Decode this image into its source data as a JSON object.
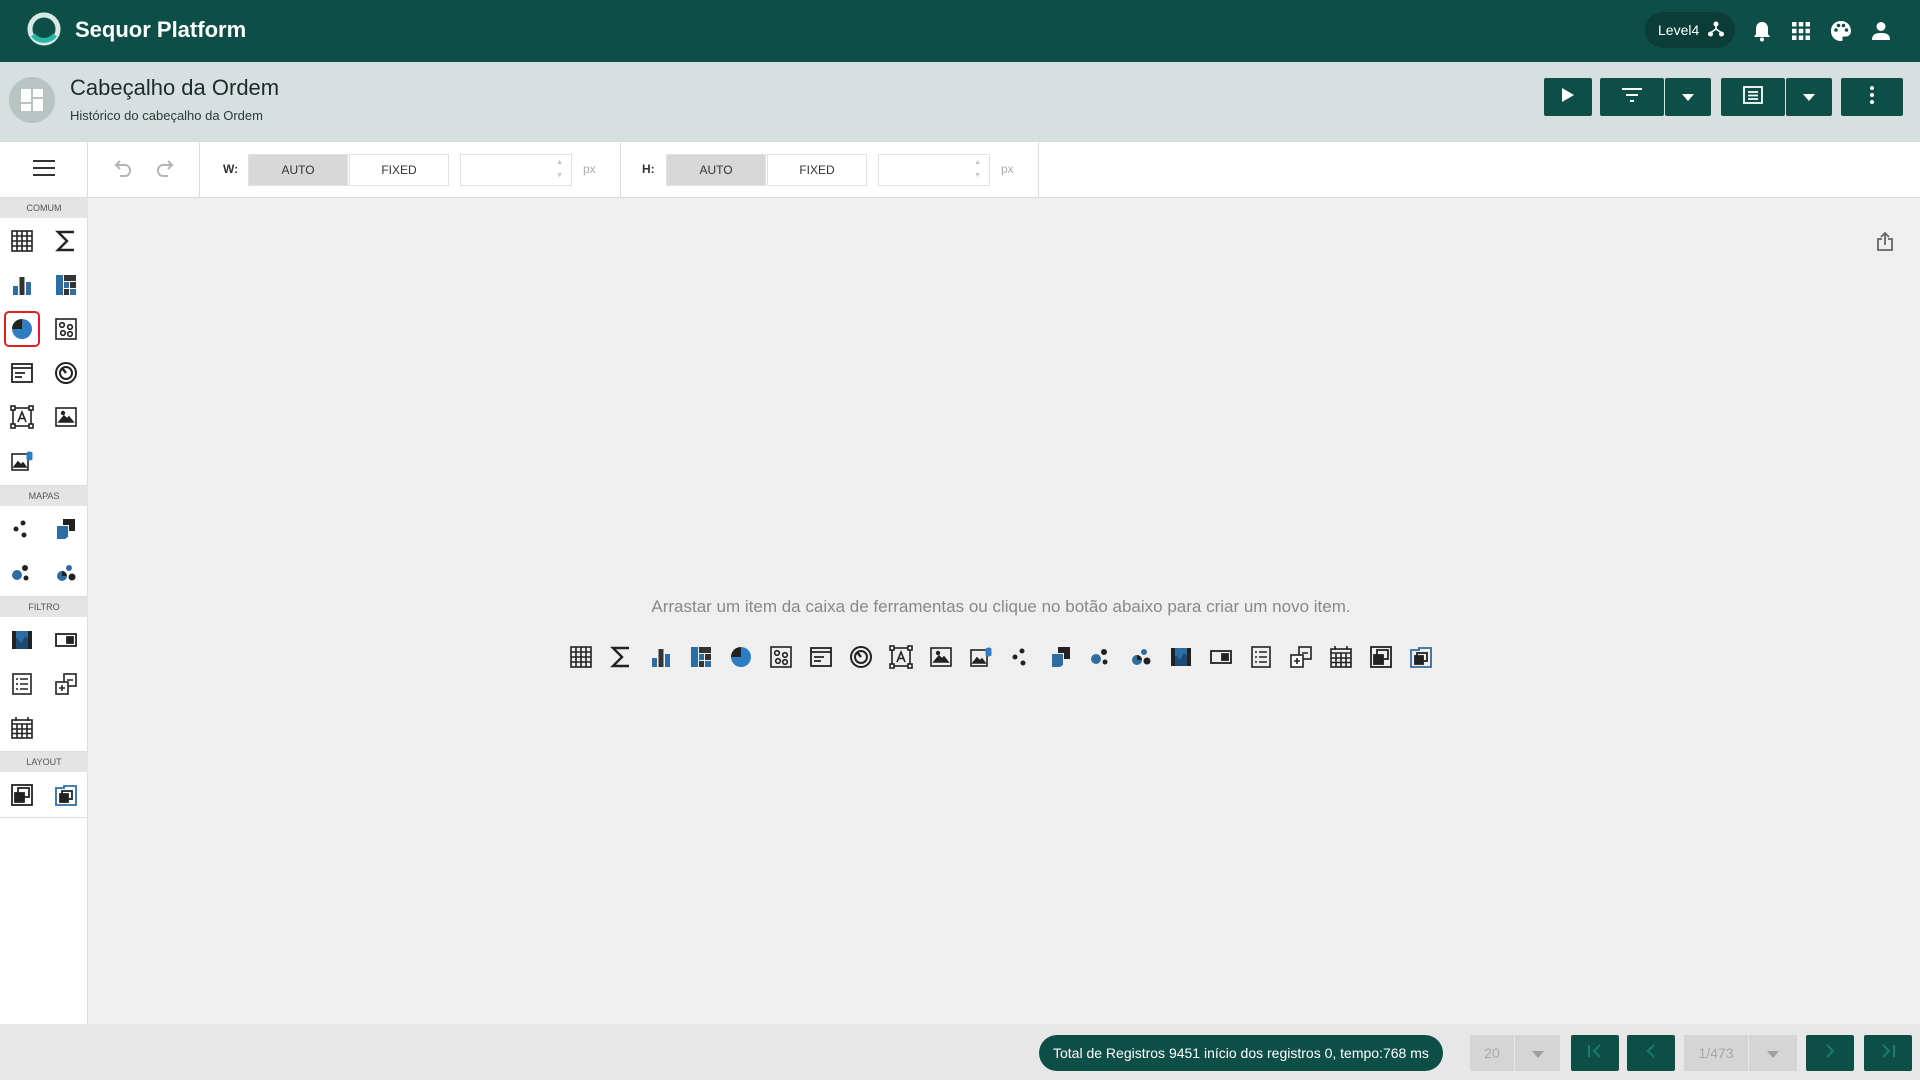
{
  "app": {
    "title": "Sequor Platform",
    "level_label": "Level4",
    "brand_color": "#0d4f47",
    "icons": [
      "logo-ring-icon",
      "hierarchy-icon",
      "bell-icon",
      "apps-grid-icon",
      "palette-icon",
      "user-icon"
    ]
  },
  "header": {
    "title": "Cabeçalho da Ordem",
    "subtitle": "Histórico do cabeçalho da Ordem",
    "buttons": [
      "play-icon",
      "filter-icon",
      "chevron-down-icon",
      "layout-list-icon",
      "chevron-down-icon",
      "more-vertical-icon"
    ]
  },
  "toolbar": {
    "width": {
      "label": "W:",
      "auto_label": "AUTO",
      "fixed_label": "FIXED",
      "value": "",
      "unit": "px",
      "active": "AUTO"
    },
    "height": {
      "label": "H:",
      "auto_label": "AUTO",
      "fixed_label": "FIXED",
      "value": "",
      "unit": "px",
      "active": "AUTO"
    },
    "icons": [
      "menu-icon",
      "undo-icon",
      "redo-icon"
    ]
  },
  "toolbox": {
    "sections": [
      {
        "label": "COMUM",
        "items": [
          "grid-icon",
          "sum-icon",
          "bar-chart-icon",
          "treemap-icon",
          "pie-chart-icon",
          "scatter-icon",
          "card-icon",
          "gauge-icon",
          "text-box-icon",
          "image-icon",
          "bound-image-icon"
        ]
      },
      {
        "label": "MAPAS",
        "items": [
          "geo-points-icon",
          "choropleth-icon",
          "bubble-map-icon",
          "pie-map-icon"
        ]
      },
      {
        "label": "FILTRO",
        "items": [
          "range-filter-icon",
          "combo-box-icon",
          "list-box-icon",
          "tree-view-icon",
          "date-filter-icon"
        ]
      },
      {
        "label": "LAYOUT",
        "items": [
          "group-icon",
          "tab-container-icon"
        ]
      }
    ],
    "selected_item": "pie-chart-icon"
  },
  "canvas": {
    "empty_message": "Arrastar um item da caixa de ferramentas ou clique no botão abaixo para criar um novo item.",
    "create_items": [
      "grid-icon",
      "sum-icon",
      "bar-chart-icon",
      "treemap-icon",
      "pie-chart-icon",
      "scatter-icon",
      "card-icon",
      "gauge-icon",
      "text-box-icon",
      "image-icon",
      "bound-image-icon",
      "geo-points-icon",
      "choropleth-icon",
      "bubble-map-icon",
      "pie-map-icon",
      "range-filter-icon",
      "combo-box-icon",
      "list-box-icon",
      "tree-view-icon",
      "date-filter-icon",
      "group-icon",
      "tab-container-icon"
    ],
    "export_icon": "export-icon"
  },
  "footer": {
    "total_text": "Total de Registros 9451 início dos registros 0, tempo:768 ms",
    "page_size": "20",
    "page_indicator": "1/473",
    "nav_icons": [
      "first-page-icon",
      "previous-page-icon",
      "next-page-icon",
      "last-page-icon"
    ]
  }
}
